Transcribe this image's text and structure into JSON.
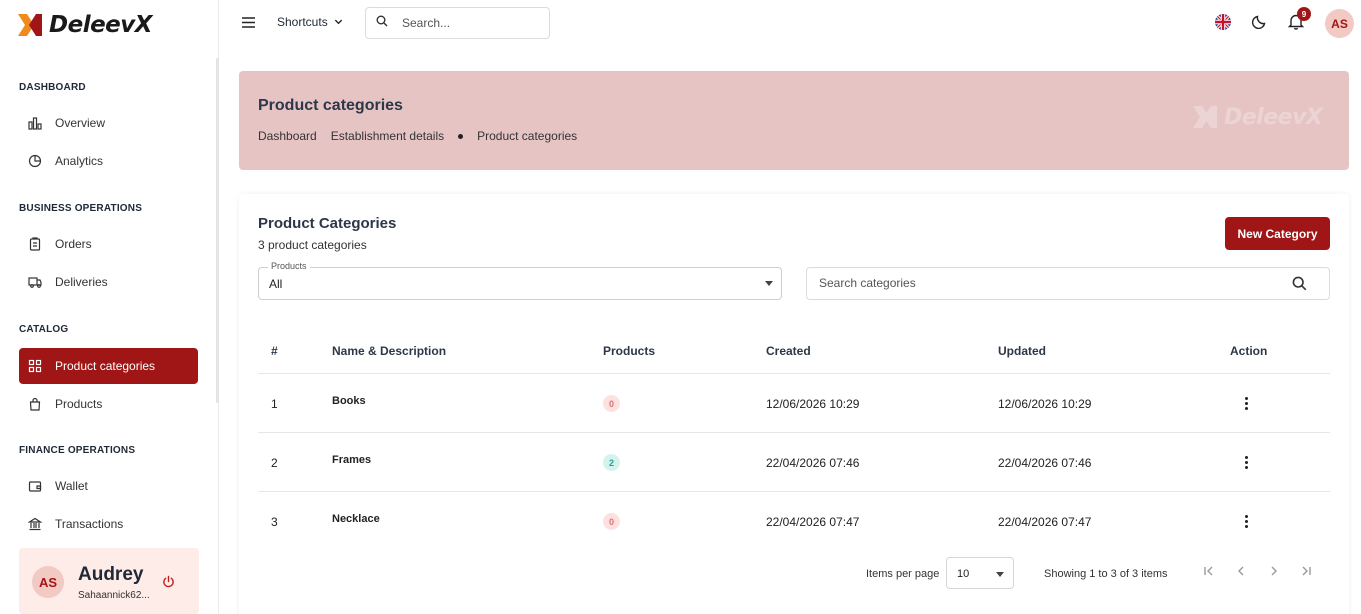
{
  "brand": {
    "name": "DeleevX",
    "accent": "#a01616"
  },
  "sidebar": {
    "sections": [
      {
        "title": "DASHBOARD"
      },
      {
        "title": "BUSINESS OPERATIONS"
      },
      {
        "title": "CATALOG"
      },
      {
        "title": "FINANCE OPERATIONS"
      }
    ],
    "items": [
      {
        "label": "Overview",
        "icon": "bar-chart-icon"
      },
      {
        "label": "Analytics",
        "icon": "pie-chart-icon"
      },
      {
        "label": "Orders",
        "icon": "clipboard-icon"
      },
      {
        "label": "Deliveries",
        "icon": "truck-icon"
      },
      {
        "label": "Product categories",
        "icon": "grid-icon",
        "active": true
      },
      {
        "label": "Products",
        "icon": "bag-icon"
      },
      {
        "label": "Wallet",
        "icon": "wallet-icon"
      },
      {
        "label": "Transactions",
        "icon": "bank-icon"
      }
    ],
    "user": {
      "initials": "AS",
      "name": "Audrey",
      "handle": "Sahaannick62..."
    }
  },
  "topbar": {
    "shortcuts_label": "Shortcuts",
    "search_placeholder": "Search...",
    "notification_count": "9",
    "avatar_initials": "AS"
  },
  "banner": {
    "title": "Product categories",
    "breadcrumb": [
      "Dashboard",
      "Establishment details",
      "Product categories"
    ],
    "watermark": "DeleevX"
  },
  "card": {
    "title": "Product Categories",
    "subtitle": "3 product categories",
    "new_button": "New Category",
    "filter": {
      "label": "Products",
      "value": "All"
    },
    "search_placeholder": "Search categories",
    "columns": [
      "#",
      "Name & Description",
      "Products",
      "Created",
      "Updated",
      "Action"
    ],
    "rows": [
      {
        "num": "1",
        "name": "Books",
        "products": "0",
        "created": "12/06/2026 10:29",
        "updated": "12/06/2026 10:29"
      },
      {
        "num": "2",
        "name": "Frames",
        "products": "2",
        "created": "22/04/2026 07:46",
        "updated": "22/04/2026 07:46"
      },
      {
        "num": "3",
        "name": "Necklace",
        "products": "0",
        "created": "22/04/2026 07:47",
        "updated": "22/04/2026 07:47"
      }
    ],
    "pagination": {
      "items_per_page_label": "Items per page",
      "items_per_page": "10",
      "showing": "Showing 1 to 3 of 3 items"
    }
  }
}
